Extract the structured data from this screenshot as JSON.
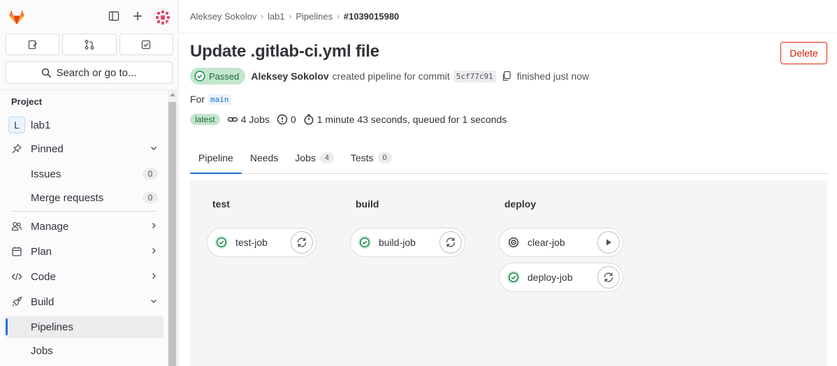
{
  "sidebar": {
    "search_label": "Search or go to...",
    "section_title": "Project",
    "project": {
      "initial": "L",
      "name": "lab1"
    },
    "pinned": {
      "label": "Pinned",
      "items": [
        {
          "label": "Issues",
          "count": "0"
        },
        {
          "label": "Merge requests",
          "count": "0"
        }
      ]
    },
    "menu": [
      {
        "label": "Manage",
        "icon": "users-icon"
      },
      {
        "label": "Plan",
        "icon": "calendar-icon"
      },
      {
        "label": "Code",
        "icon": "code-icon"
      },
      {
        "label": "Build",
        "icon": "rocket-icon"
      }
    ],
    "build_items": [
      {
        "label": "Pipelines",
        "active": true
      },
      {
        "label": "Jobs",
        "active": false
      }
    ]
  },
  "breadcrumb": [
    "Aleksey Sokolov",
    "lab1",
    "Pipelines",
    "#1039015980"
  ],
  "header": {
    "title": "Update .gitlab-ci.yml file",
    "delete_label": "Delete",
    "status": "Passed",
    "author": "Aleksey Sokolov",
    "created_text": "created pipeline for commit",
    "commit_sha": "5cf77c91",
    "finished_text": "finished just now",
    "for_text": "For",
    "ref": "main",
    "latest_badge": "latest",
    "jobs_text": "4 Jobs",
    "pending_count": "0",
    "duration_text": "1 minute 43 seconds, queued for 1 seconds"
  },
  "tabs": [
    {
      "label": "Pipeline",
      "count": null,
      "active": true
    },
    {
      "label": "Needs",
      "count": null,
      "active": false
    },
    {
      "label": "Jobs",
      "count": "4",
      "active": false
    },
    {
      "label": "Tests",
      "count": "0",
      "active": false
    }
  ],
  "stages": [
    {
      "name": "test",
      "jobs": [
        {
          "name": "test-job",
          "status": "passed",
          "action": "retry"
        }
      ]
    },
    {
      "name": "build",
      "jobs": [
        {
          "name": "build-job",
          "status": "passed",
          "action": "retry"
        }
      ]
    },
    {
      "name": "deploy",
      "jobs": [
        {
          "name": "clear-job",
          "status": "manual",
          "action": "play"
        },
        {
          "name": "deploy-job",
          "status": "passed",
          "action": "retry"
        }
      ]
    }
  ],
  "colors": {
    "passed_bg": "#c3e6cd",
    "passed_fg": "#108548",
    "accent": "#1f75cb",
    "danger": "#dd2b0e"
  }
}
